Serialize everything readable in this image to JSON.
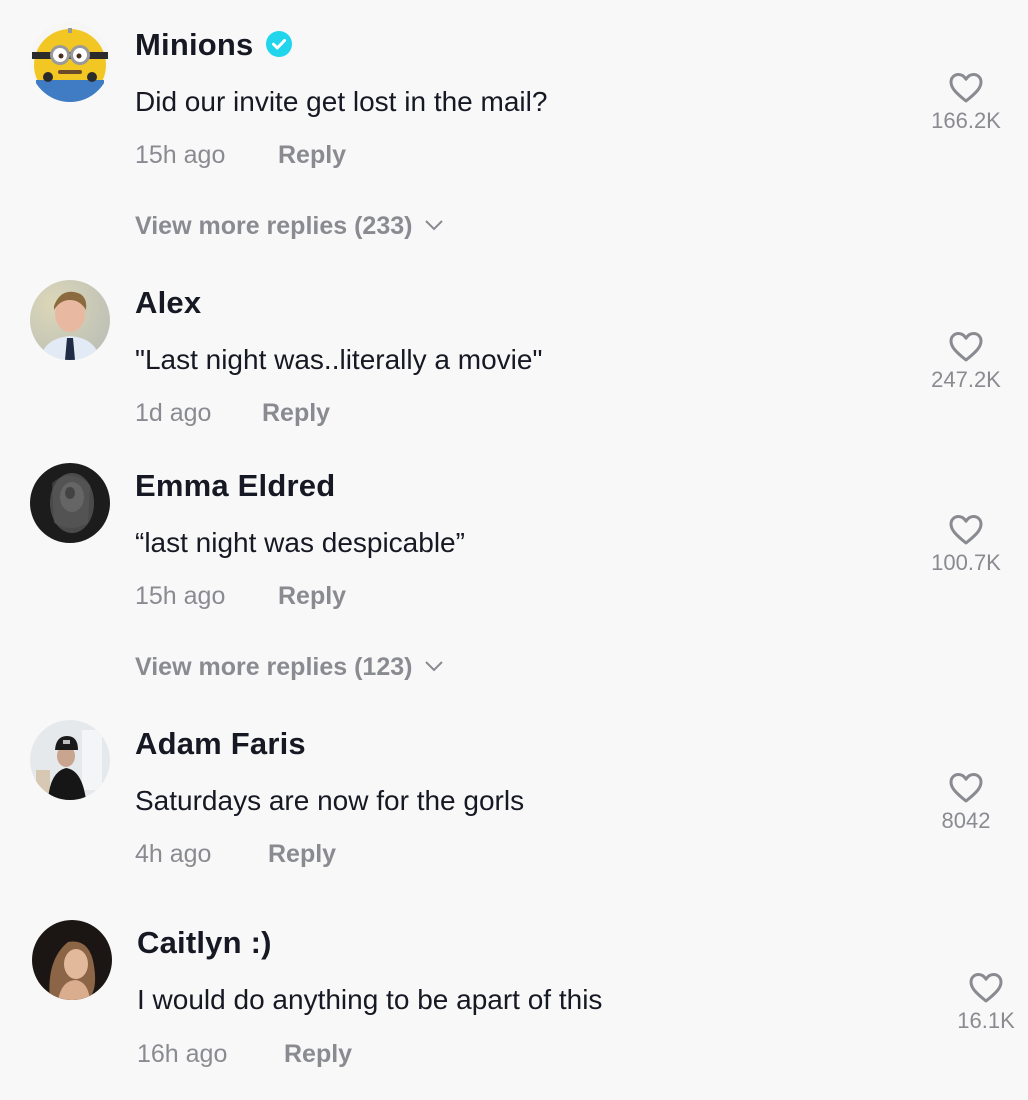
{
  "reply_label": "Reply",
  "colors": {
    "verified_badge": "#20d5ec",
    "primary_text": "#161823",
    "secondary_text": "#8a8b91"
  },
  "comments": [
    {
      "username": "Minions",
      "verified": true,
      "avatar_icon": "minion-avatar",
      "text": "Did our invite get lost in the mail?",
      "time": "15h ago",
      "likes": "166.2K",
      "view_more": "View more replies (233)"
    },
    {
      "username": "Alex",
      "verified": false,
      "avatar_icon": "user-avatar-photo",
      "text": "\"Last night was..literally a movie\"",
      "time": "1d ago",
      "likes": "247.2K"
    },
    {
      "username": "Emma Eldred",
      "verified": false,
      "avatar_icon": "user-avatar-photo",
      "text": "“last night was despicable”",
      "time": "15h ago",
      "likes": "100.7K",
      "view_more": "View more replies (123)"
    },
    {
      "username": "Adam Faris",
      "verified": false,
      "avatar_icon": "user-avatar-photo",
      "text": "Saturdays are now for the gorls",
      "time": "4h ago",
      "likes": "8042"
    },
    {
      "username": "Caitlyn :)",
      "verified": false,
      "avatar_icon": "user-avatar-photo",
      "text": "I would do anything to be apart of this",
      "time": "16h ago",
      "likes": "16.1K"
    }
  ]
}
